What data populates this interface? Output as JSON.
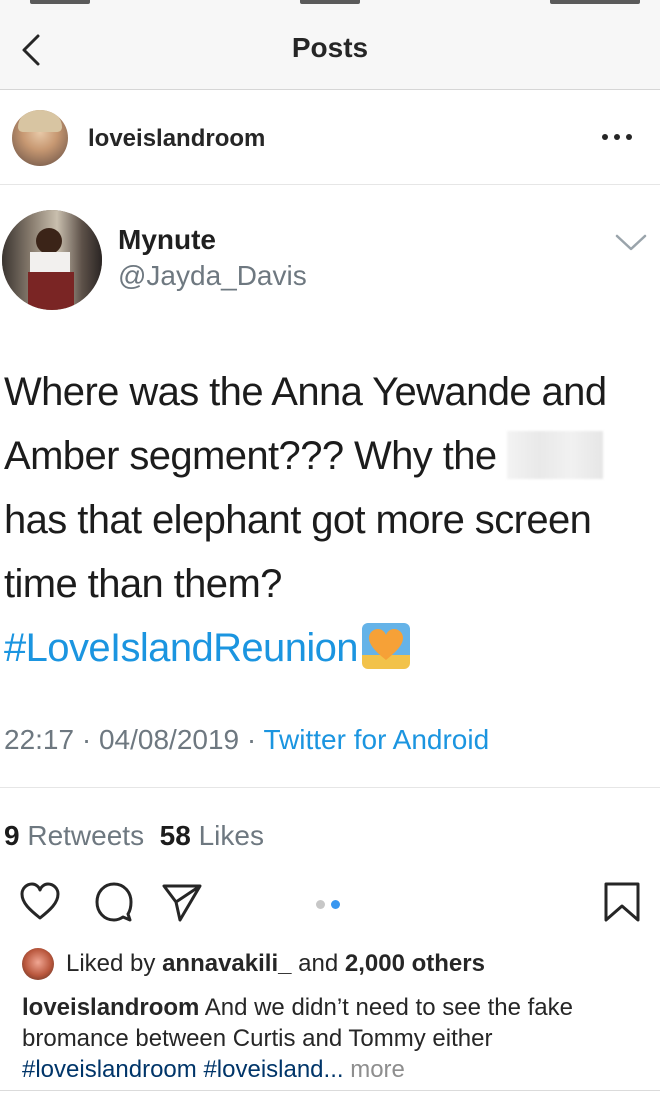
{
  "navbar": {
    "title": "Posts"
  },
  "post": {
    "username": "loveislandroom"
  },
  "tweet": {
    "display_name": "Mynute",
    "handle": "@Jayda_Davis",
    "text_line1": "Where was the Anna Yewande and",
    "text_line2a": "Amber segment??? Why the",
    "text_line3": "has that elephant got more screen",
    "text_line4": "time than them?",
    "hashtag": "#LoveIslandReunion",
    "time": "22:17",
    "date": "04/08/2019",
    "source": "Twitter for Android",
    "retweets_count": "9",
    "retweets_label": "Retweets",
    "likes_count": "58",
    "likes_label": "Likes"
  },
  "engagement": {
    "liked_by_prefix": "Liked by",
    "liked_by_user": "annavakili_",
    "liked_by_and": "and",
    "liked_by_others": "2,000 others"
  },
  "caption": {
    "username": "loveislandroom",
    "text": "And we didn’t need to see the fake bromance between Curtis and Tommy either",
    "tag1": "#loveislandroom",
    "tag2": "#loveisland...",
    "more": "more"
  },
  "colors": {
    "link_blue": "#1b95e0",
    "caption_tag": "#003569",
    "muted": "#8e8e8e",
    "carousel_active": "#3897f0",
    "carousel_inactive": "#c7c7c7"
  },
  "icons": {
    "back": "chevron-left-icon",
    "more": "ellipsis-icon",
    "tweet_menu": "chevron-down-icon",
    "like": "heart-icon",
    "comment": "comment-icon",
    "share": "send-icon",
    "save": "bookmark-icon"
  }
}
